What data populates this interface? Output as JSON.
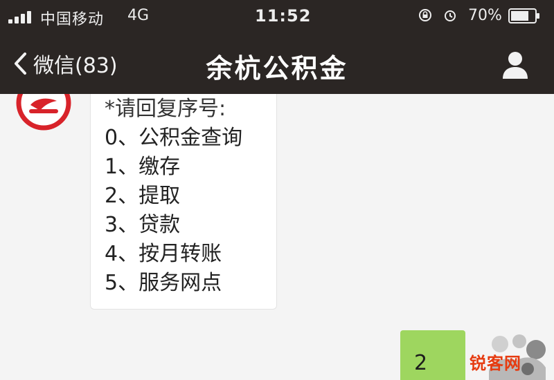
{
  "status_bar": {
    "carrier": "中国移动",
    "network": "4G",
    "time": "11:52",
    "battery_percent": "70%",
    "icons": [
      "signal-bars-icon",
      "lock-rotation-icon",
      "alarm-icon",
      "battery-icon"
    ]
  },
  "nav": {
    "back_label": "微信(83)",
    "title": "余杭公积金",
    "back_icon": "chevron-left-icon",
    "profile_icon": "person-icon"
  },
  "messages": {
    "received": {
      "lines": [
        "*请回复序号:",
        "0、公积金查询",
        "1、缴存",
        "2、提取",
        "3、贷款",
        "4、按月转账",
        "5、服务网点"
      ]
    },
    "sent": {
      "text": "2"
    }
  },
  "watermark": "锐客网",
  "colors": {
    "header_bg": "#2b2624",
    "chat_bg": "#f4f4f4",
    "sent_bubble": "#9ed65f",
    "received_bubble": "#ffffff",
    "avatar_red": "#d8232a",
    "watermark": "#e63b10"
  }
}
